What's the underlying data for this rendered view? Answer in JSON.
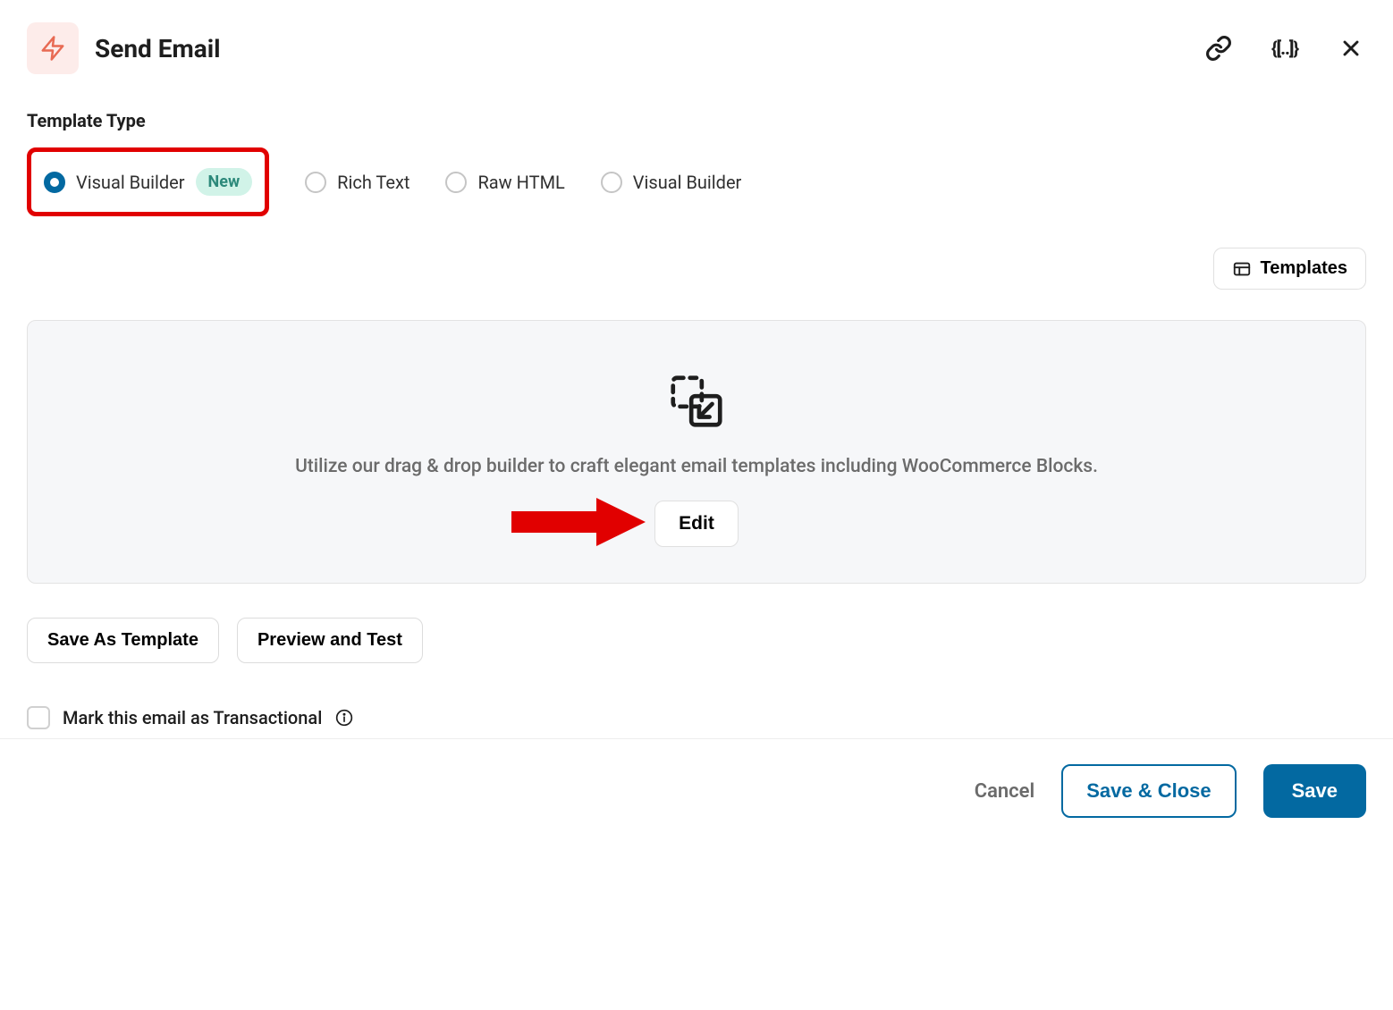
{
  "header": {
    "title": "Send Email"
  },
  "template_type": {
    "label": "Template Type",
    "options": [
      {
        "label": "Visual Builder",
        "badge": "New",
        "selected": true
      },
      {
        "label": "Rich Text",
        "selected": false
      },
      {
        "label": "Raw HTML",
        "selected": false
      },
      {
        "label": "Visual Builder",
        "selected": false
      }
    ]
  },
  "templates_button": "Templates",
  "builder_panel": {
    "description": "Utilize our drag & drop builder to craft elegant email templates including WooCommerce Blocks.",
    "edit_label": "Edit"
  },
  "actions": {
    "save_template": "Save As Template",
    "preview_test": "Preview and Test"
  },
  "transactional": {
    "label": "Mark this email as Transactional"
  },
  "footer": {
    "cancel": "Cancel",
    "save_close": "Save & Close",
    "save": "Save"
  },
  "colors": {
    "accent": "#0369a1",
    "highlight": "#e10000",
    "badge_bg": "#d1f3e8",
    "badge_text": "#2c897a",
    "icon_bg": "#fdecea"
  }
}
